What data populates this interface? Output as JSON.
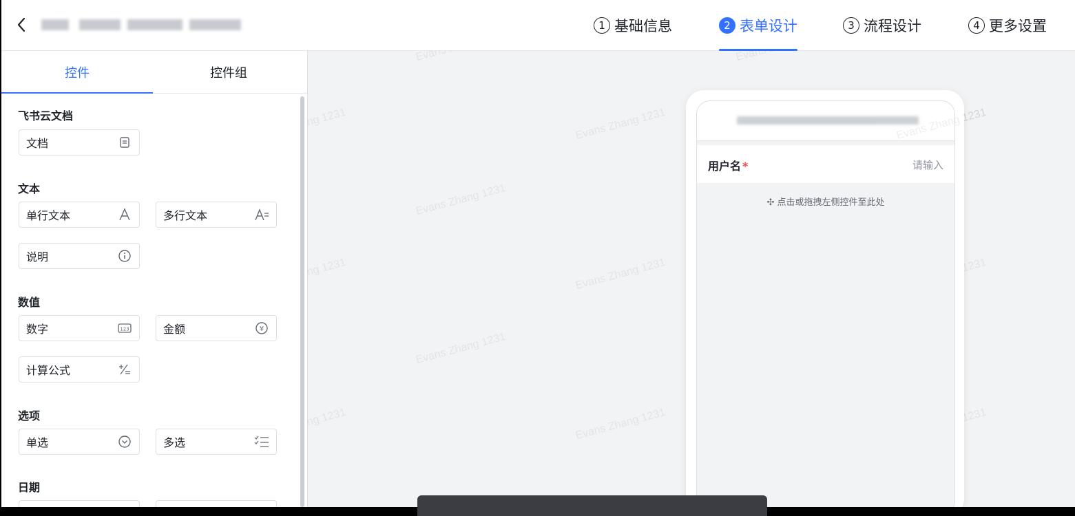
{
  "header": {
    "steps": [
      {
        "num": "1",
        "label": "基础信息"
      },
      {
        "num": "2",
        "label": "表单设计"
      },
      {
        "num": "3",
        "label": "流程设计"
      },
      {
        "num": "4",
        "label": "更多设置"
      }
    ]
  },
  "left_panel": {
    "tabs": [
      "控件",
      "控件组"
    ],
    "sections": {
      "doc": {
        "title": "飞书云文档",
        "items": [
          "文档"
        ]
      },
      "text": {
        "title": "文本",
        "items": [
          "单行文本",
          "多行文本",
          "说明"
        ]
      },
      "number": {
        "title": "数值",
        "items": [
          "数字",
          "金额",
          "计算公式"
        ]
      },
      "option": {
        "title": "选项",
        "items": [
          "单选",
          "多选"
        ]
      },
      "date": {
        "title": "日期"
      }
    }
  },
  "phone": {
    "field": {
      "label": "用户名",
      "required_mark": "*",
      "placeholder": "请输入"
    },
    "drop_hint": "✣ 点击或拖拽左侧控件至此处"
  },
  "watermark": "Evans Zhang 1231",
  "icons": {
    "back": "chevron-left-icon",
    "doc": "document-icon",
    "single_text": "text-a-icon",
    "multi_text": "text-lines-icon",
    "desc": "info-icon",
    "number": "number-123-icon",
    "amount": "currency-icon",
    "formula": "formula-icon",
    "single_choice": "circle-chevron-down-icon",
    "multi_choice": "checklist-icon"
  },
  "colors": {
    "accent": "#3370ff",
    "required": "#f54a45"
  }
}
